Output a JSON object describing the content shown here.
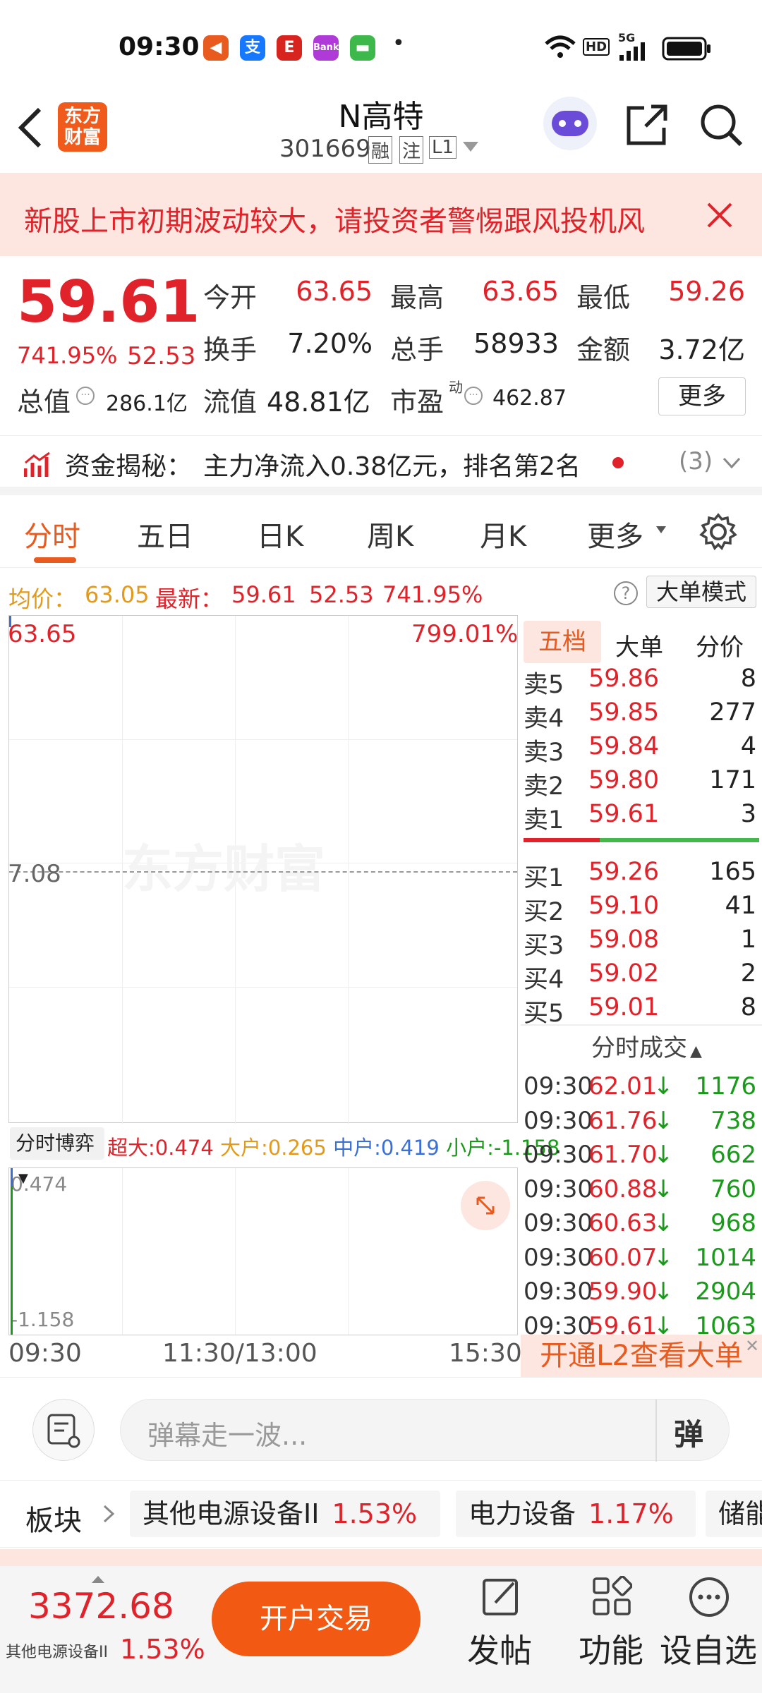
{
  "status_bar": {
    "time": "09:30",
    "dot": "•",
    "hd": "HD",
    "net": "5G"
  },
  "header": {
    "title": "N高特",
    "code": "301669",
    "badges": [
      "融",
      "注",
      "L1"
    ],
    "logo_line1": "东方",
    "logo_line2": "财富"
  },
  "banner": {
    "text": "新股上市初期波动较大，请投资者警惕跟风投机风"
  },
  "quote": {
    "price": "59.61",
    "change_pct": "741.95%",
    "change_amt": "52.53",
    "open_label": "今开",
    "open": "63.65",
    "high_label": "最高",
    "high": "63.65",
    "low_label": "最低",
    "low": "59.26",
    "turnover_label": "换手",
    "turnover": "7.20%",
    "volume_label": "总手",
    "volume": "58933",
    "amount_label": "金额",
    "amount": "3.72亿",
    "mcap_label": "总值",
    "mcap": "286.1亿",
    "float_label": "流值",
    "float_value": "48.81亿",
    "pe_label": "市盈",
    "pe_sup": "动",
    "pe": "462.87",
    "more_button": "更多"
  },
  "flow": {
    "label": "资金揭秘：",
    "text": "主力净流入0.38亿元，排名第2名",
    "count": "(3)"
  },
  "tabs": [
    "分时",
    "五日",
    "日K",
    "周K",
    "月K",
    "更多"
  ],
  "infobar": {
    "avg_label": "均价：",
    "avg": "63.05",
    "latest_label": "最新：",
    "latest": "59.61",
    "chg": "52.53",
    "pct": "741.95%",
    "mode_button": "大单模式"
  },
  "chart": {
    "top_price": "63.65",
    "top_pct": "799.01%",
    "mid_price": "7.08",
    "watermark": "东方财富",
    "game_label": "分时博弈",
    "super_label": "超大:",
    "super": "0.474",
    "large_label": "大户:",
    "large": "0.265",
    "mid_label": "中户:",
    "mid": "0.419",
    "small_label": "小户:",
    "small": "-1.158",
    "sub_top": "0.474",
    "sub_bottom": "-1.158",
    "time_start": "09:30",
    "time_mid": "11:30/13:00",
    "time_end": "15:30"
  },
  "orderbook": {
    "tabs": [
      "五档",
      "大单",
      "分价"
    ],
    "asks": [
      {
        "label": "卖5",
        "price": "59.86",
        "vol": "8"
      },
      {
        "label": "卖4",
        "price": "59.85",
        "vol": "277"
      },
      {
        "label": "卖3",
        "price": "59.84",
        "vol": "4"
      },
      {
        "label": "卖2",
        "price": "59.80",
        "vol": "171"
      },
      {
        "label": "卖1",
        "price": "59.61",
        "vol": "3"
      }
    ],
    "bids": [
      {
        "label": "买1",
        "price": "59.26",
        "vol": "165"
      },
      {
        "label": "买2",
        "price": "59.10",
        "vol": "41"
      },
      {
        "label": "买3",
        "price": "59.08",
        "vol": "1"
      },
      {
        "label": "买4",
        "price": "59.02",
        "vol": "2"
      },
      {
        "label": "买5",
        "price": "59.01",
        "vol": "8"
      }
    ],
    "trades_title": "分时成交",
    "trades": [
      {
        "time": "09:30",
        "price": "62.01",
        "vol": "1176"
      },
      {
        "time": "09:30",
        "price": "61.76",
        "vol": "738"
      },
      {
        "time": "09:30",
        "price": "61.70",
        "vol": "662"
      },
      {
        "time": "09:30",
        "price": "60.88",
        "vol": "760"
      },
      {
        "time": "09:30",
        "price": "60.63",
        "vol": "968"
      },
      {
        "time": "09:30",
        "price": "60.07",
        "vol": "1014"
      },
      {
        "time": "09:30",
        "price": "59.90",
        "vol": "2904"
      },
      {
        "time": "09:30",
        "price": "59.61",
        "vol": "1063"
      }
    ],
    "l2_text": "开通L2查看大单"
  },
  "danmu": {
    "placeholder": "弹幕走一波...",
    "button": "弹"
  },
  "sectors": {
    "label": "板块",
    "items": [
      {
        "name": "其他电源设备II",
        "pct": "1.53%"
      },
      {
        "name": "电力设备",
        "pct": "1.17%"
      },
      {
        "name": "储能",
        "pct": ""
      }
    ]
  },
  "bottom": {
    "index_value": "3372.68",
    "index_name": "其他电源设备II",
    "index_pct": "1.53%",
    "trade_button": "开户交易",
    "nav": [
      {
        "label": "发帖"
      },
      {
        "label": "功能"
      },
      {
        "label": "设自选"
      }
    ]
  }
}
